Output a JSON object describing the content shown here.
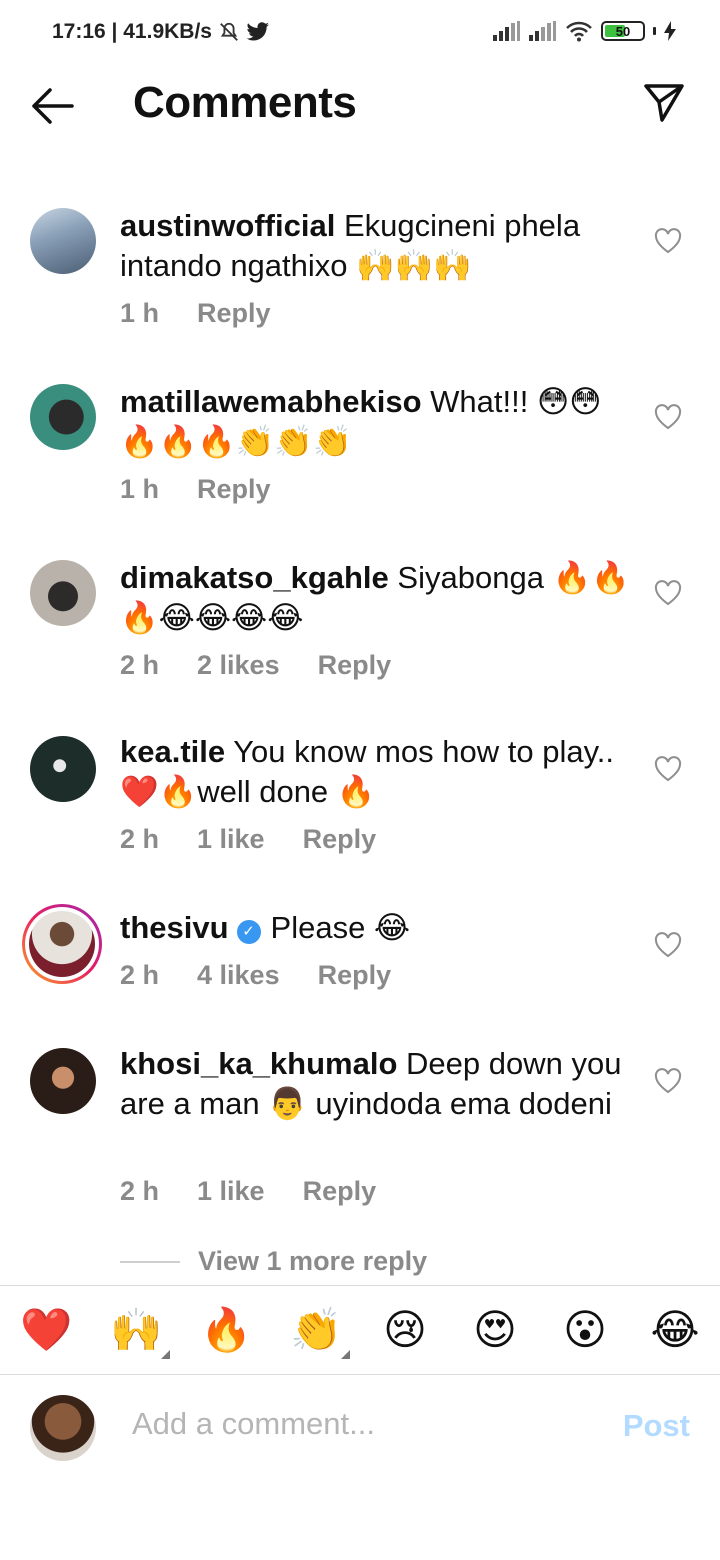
{
  "status": {
    "time_speed": "17:16 | 41.9KB/s",
    "battery": "50"
  },
  "header": {
    "title": "Comments"
  },
  "comments": [
    {
      "user": "austinwofficial",
      "text": "Ekugcineni phela intando ngathixo 🙌🙌🙌",
      "time": "1 h",
      "likes": "",
      "reply": "Reply"
    },
    {
      "user": "matillawemabhekiso",
      "text": "What!!! 😳😳🔥🔥🔥👏👏👏",
      "time": "1 h",
      "likes": "",
      "reply": "Reply"
    },
    {
      "user": "dimakatso_kgahle",
      "text": "Siyabonga 🔥🔥🔥😂😂😂😂",
      "time": "2 h",
      "likes": "2 likes",
      "reply": "Reply"
    },
    {
      "user": "kea.tile",
      "text": "You know mos how to play.. ❤️🔥well done 🔥",
      "time": "2 h",
      "likes": "1 like",
      "reply": "Reply"
    },
    {
      "user": "thesivu",
      "text": "Please 😂",
      "time": "2 h",
      "likes": "4 likes",
      "reply": "Reply"
    },
    {
      "user": "khosi_ka_khumalo",
      "text": "Deep down you are a man 👨 uyindoda ema dodeni",
      "time": "2 h",
      "likes": "1 like",
      "reply": "Reply"
    }
  ],
  "view_more": "View 1 more reply",
  "reactions": [
    "❤️",
    "🙌",
    "🔥",
    "👏",
    "😢",
    "😍",
    "😮",
    "😂"
  ],
  "add_comment": {
    "placeholder": "Add a comment...",
    "post_label": "Post"
  }
}
